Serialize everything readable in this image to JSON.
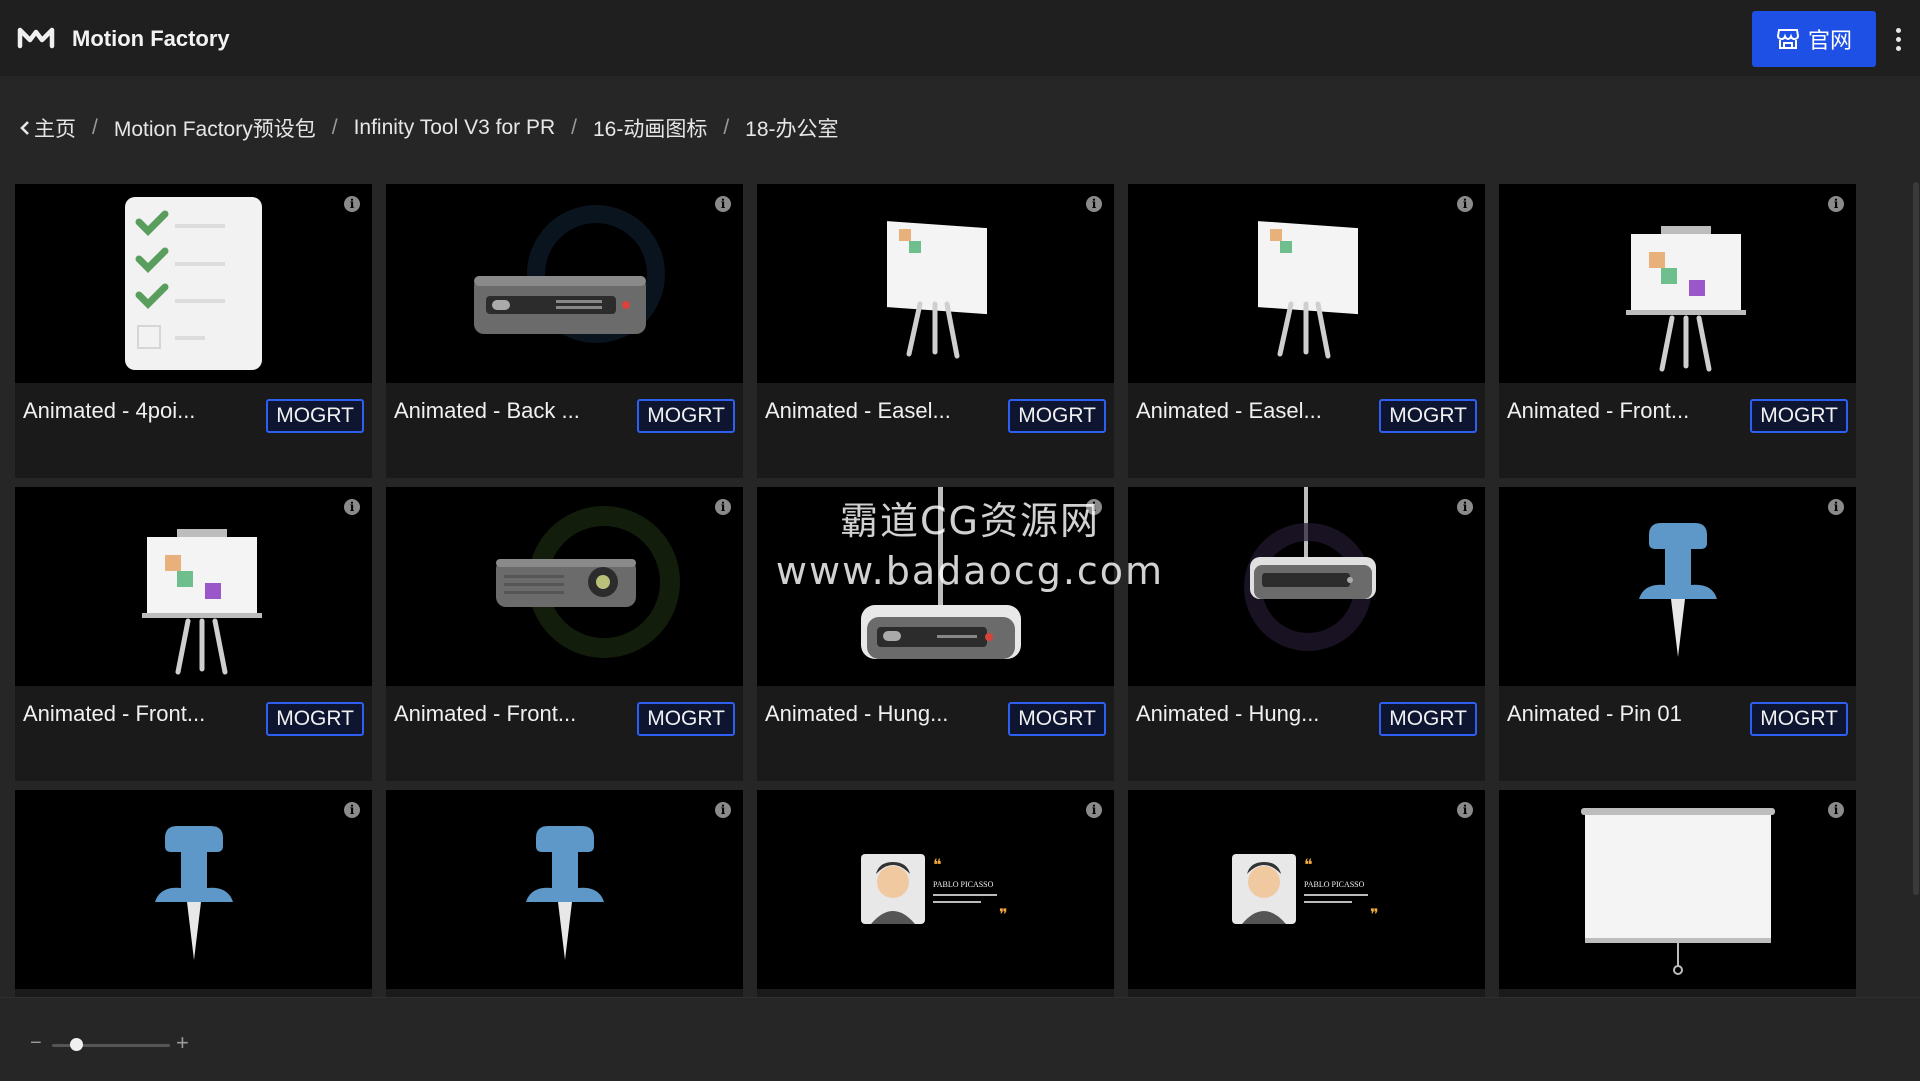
{
  "app": {
    "title": "Motion Factory",
    "site_button_label": "官网"
  },
  "breadcrumb": [
    {
      "label": "主页"
    },
    {
      "label": "Motion Factory预设包"
    },
    {
      "label": "Infinity Tool V3 for PR"
    },
    {
      "label": "16-动画图标"
    },
    {
      "label": "18-办公室"
    }
  ],
  "items": [
    {
      "name": "Animated - 4poi...",
      "badge": "MOGRT",
      "icon": "checklist-icon"
    },
    {
      "name": "Animated - Back ...",
      "badge": "MOGRT",
      "icon": "projector-back-icon"
    },
    {
      "name": "Animated - Easel...",
      "badge": "MOGRT",
      "icon": "easel-icon"
    },
    {
      "name": "Animated - Easel...",
      "badge": "MOGRT",
      "icon": "easel-icon"
    },
    {
      "name": "Animated - Front...",
      "badge": "MOGRT",
      "icon": "easel-front-icon"
    },
    {
      "name": "Animated - Front...",
      "badge": "MOGRT",
      "icon": "easel-front-icon"
    },
    {
      "name": "Animated - Front...",
      "badge": "MOGRT",
      "icon": "projector-front-icon"
    },
    {
      "name": "Animated - Hung...",
      "badge": "MOGRT",
      "icon": "projector-hung-icon"
    },
    {
      "name": "Animated - Hung...",
      "badge": "MOGRT",
      "icon": "projector-hung-small-icon"
    },
    {
      "name": "Animated - Pin 01",
      "badge": "MOGRT",
      "icon": "pushpin-icon"
    },
    {
      "name": "",
      "badge": "",
      "icon": "pushpin-icon"
    },
    {
      "name": "",
      "badge": "",
      "icon": "pushpin-icon"
    },
    {
      "name": "",
      "badge": "",
      "icon": "quote-card-icon"
    },
    {
      "name": "",
      "badge": "",
      "icon": "quote-card-icon"
    },
    {
      "name": "",
      "badge": "",
      "icon": "projection-screen-icon"
    }
  ],
  "quote_card": {
    "author": "PABLO PICASSO"
  },
  "watermark": {
    "line1": "霸道CG资源网",
    "line2": "www.badaocg.com"
  },
  "zoom": {
    "level": 0.2
  },
  "colors": {
    "accent": "#1e50e6",
    "badge_border": "#2e5ff0",
    "background": "#262626",
    "topbar": "#1f1f1f"
  }
}
